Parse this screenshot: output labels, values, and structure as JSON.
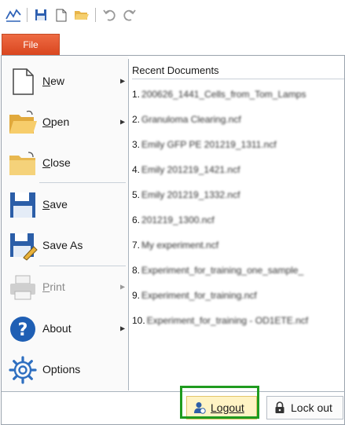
{
  "toolbar": {
    "icons": [
      "chart-line-icon",
      "save-icon",
      "new-document-icon",
      "open-folder-icon",
      "undo-icon",
      "redo-icon"
    ]
  },
  "file_tab": {
    "label": "File"
  },
  "menu": {
    "items": [
      {
        "label": "New",
        "icon": "new-document-icon",
        "submenu": true
      },
      {
        "label": "Open",
        "icon": "open-folder-icon",
        "submenu": true
      },
      {
        "label": "Close",
        "icon": "close-folder-icon",
        "submenu": false
      },
      {
        "label": "Save",
        "icon": "save-icon",
        "submenu": false
      },
      {
        "label": "Save As",
        "icon": "save-as-icon",
        "submenu": false
      },
      {
        "label": "Print",
        "icon": "printer-icon",
        "submenu": true,
        "disabled": true
      },
      {
        "label": "About",
        "icon": "help-icon",
        "submenu": true
      },
      {
        "label": "Options",
        "icon": "gear-icon",
        "submenu": false
      }
    ]
  },
  "recent": {
    "title": "Recent Documents",
    "docs": [
      {
        "num": "1.",
        "name": "200626_1441_Cells_from_Tom_Lamps"
      },
      {
        "num": "2.",
        "name": "Granuloma Clearing.ncf"
      },
      {
        "num": "3.",
        "name": "Emily GFP PE 201219_1311.ncf"
      },
      {
        "num": "4.",
        "name": "Emily 201219_1421.ncf"
      },
      {
        "num": "5.",
        "name": "Emily 201219_1332.ncf"
      },
      {
        "num": "6.",
        "name": "201219_1300.ncf"
      },
      {
        "num": "7.",
        "name": "My experiment.ncf"
      },
      {
        "num": "8.",
        "name": "Experiment_for_training_one_sample_"
      },
      {
        "num": "9.",
        "name": "Experiment_for_training.ncf"
      },
      {
        "num": "10.",
        "name": "Experiment_for_training - OD1ETE.ncf"
      }
    ]
  },
  "buttons": {
    "logout": "Logout",
    "lockout": "Lock out"
  },
  "colors": {
    "file_tab": "#e2562c",
    "highlight_frame": "#1f9b1f",
    "logout_bg": "#fff3c4"
  }
}
